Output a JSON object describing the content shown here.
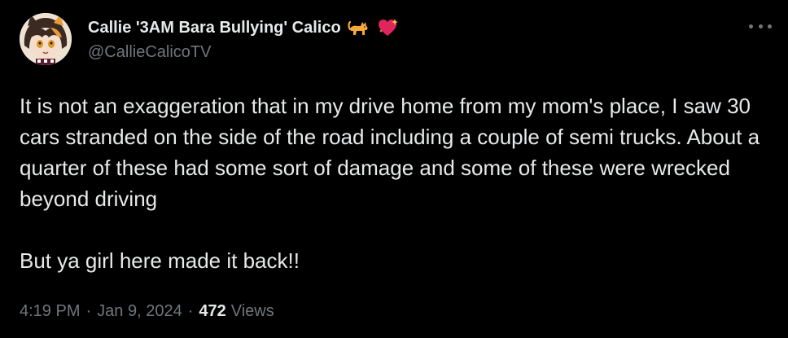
{
  "author": {
    "display_name": "Callie '3AM Bara Bullying' Calico",
    "handle": "@CallieCalicoTV",
    "badges": [
      "cat-emoji",
      "sparkling-heart-emoji"
    ]
  },
  "tweet": {
    "paragraphs": [
      "It is not an exaggeration that in my drive home from my mom's place, I saw 30 cars stranded on the side of the road including a couple of semi trucks. About a quarter of these had some sort of damage and some of these were wrecked beyond driving",
      "But ya girl here made it back!!"
    ],
    "time": "4:19 PM",
    "separator": "·",
    "date": "Jan 9, 2024",
    "views_count": "472",
    "views_label": "Views"
  },
  "colors": {
    "background": "#000000",
    "text": "#e7e9ea",
    "muted": "#71767b"
  }
}
